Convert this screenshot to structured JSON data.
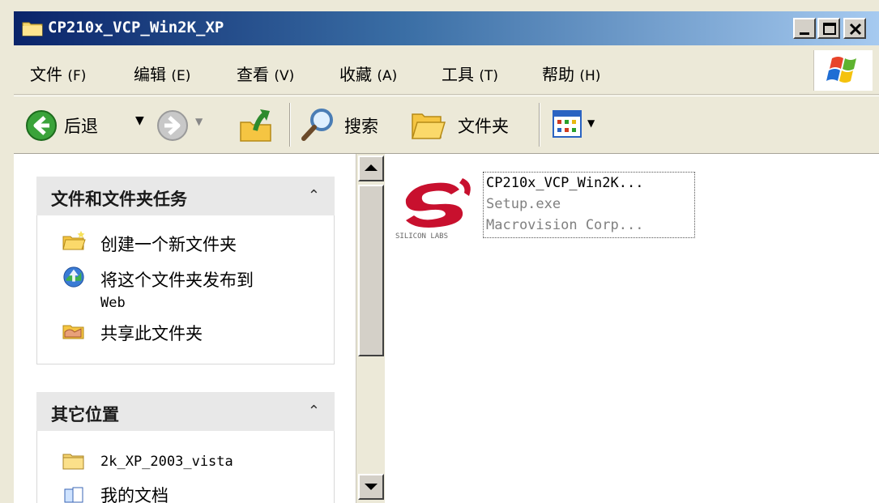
{
  "window": {
    "title": "CP210x_VCP_Win2K_XP"
  },
  "menu": [
    {
      "label": "文件",
      "accel": "(F)"
    },
    {
      "label": "编辑",
      "accel": "(E)"
    },
    {
      "label": "查看",
      "accel": "(V)"
    },
    {
      "label": "收藏",
      "accel": "(A)"
    },
    {
      "label": "工具",
      "accel": "(T)"
    },
    {
      "label": "帮助",
      "accel": "(H)"
    }
  ],
  "toolbar": {
    "back_label": "后退",
    "search_label": "搜索",
    "folders_label": "文件夹",
    "icons": [
      "back-arrow-icon",
      "forward-arrow-icon",
      "up-folder-icon",
      "search-magnifier-icon",
      "folders-icon",
      "views-icon"
    ]
  },
  "tasks_panel": {
    "title": "文件和文件夹任务",
    "items": [
      {
        "label": "创建一个新文件夹",
        "icon": "new-folder-icon"
      },
      {
        "label": "将这个文件夹发布到",
        "label2": "Web",
        "icon": "publish-web-icon"
      },
      {
        "label": "共享此文件夹",
        "icon": "share-folder-icon"
      }
    ]
  },
  "other_places": {
    "title": "其它位置",
    "items": [
      {
        "label": "2k_XP_2003_vista",
        "icon": "folder-icon"
      },
      {
        "label": "我的文档",
        "icon": "my-documents-icon"
      }
    ]
  },
  "file": {
    "name": "CP210x_VCP_Win2K...",
    "type": "Setup.exe",
    "company": "Macrovision Corp...",
    "icon_text": "SILICON LABS"
  },
  "colors": {
    "title_start": "#0a246a",
    "title_end": "#a6caf0",
    "brand_red": "#c8102e"
  }
}
